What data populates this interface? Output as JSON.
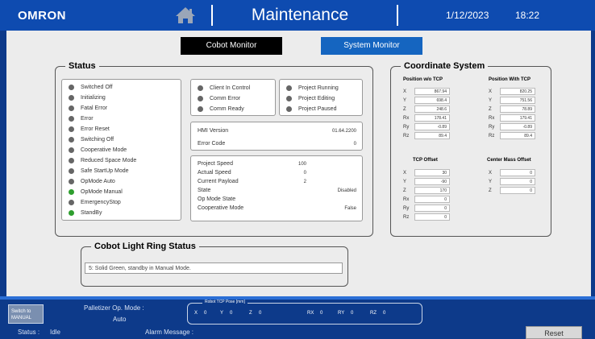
{
  "header": {
    "logo": "OMRON",
    "title": "Maintenance",
    "date": "1/12/2023",
    "time": "18:22"
  },
  "tabs": [
    {
      "label": "Cobot Monitor"
    },
    {
      "label": "System Monitor"
    }
  ],
  "status": {
    "legend": "Status",
    "states": [
      {
        "label": "Switched Off",
        "on": false
      },
      {
        "label": "Initializing",
        "on": false
      },
      {
        "label": "Fatal Error",
        "on": false
      },
      {
        "label": "Error",
        "on": false
      },
      {
        "label": "Error Reset",
        "on": false
      },
      {
        "label": "Switching Off",
        "on": false
      },
      {
        "label": "Cooperative Mode",
        "on": false
      },
      {
        "label": "Reduced Space Mode",
        "on": false
      },
      {
        "label": "Safe StartUp Mode",
        "on": false
      },
      {
        "label": "OpMode Auto",
        "on": false
      },
      {
        "label": "OpMode Manual",
        "on": true
      },
      {
        "label": "EmergencyStop",
        "on": false
      },
      {
        "label": "StandBy",
        "on": true
      }
    ],
    "comm": [
      {
        "label": "Client In Control"
      },
      {
        "label": "Comm Error"
      },
      {
        "label": "Comm Ready"
      }
    ],
    "project": [
      {
        "label": "Project Running"
      },
      {
        "label": "Project Editing"
      },
      {
        "label": "Project Paused"
      }
    ],
    "hmi": {
      "label": "HMI Version",
      "value": "01.64.2200"
    },
    "error_code": {
      "label": "Error Code",
      "value": "0"
    },
    "project_info": [
      {
        "label": "Project Speed",
        "value": "100"
      },
      {
        "label": "Actual Speed",
        "value": "0"
      },
      {
        "label": "Current Payload",
        "value": "2"
      },
      {
        "label": "State",
        "value": "Disabled"
      },
      {
        "label": "Op Mode State",
        "value": ""
      },
      {
        "label": "Cooperative Mode",
        "value": "False"
      }
    ]
  },
  "coord": {
    "legend": "Coordinate System",
    "pos_wo_tcp": {
      "title": "Position w/o TCP",
      "rows": [
        {
          "k": "X",
          "v": "867.94"
        },
        {
          "k": "Y",
          "v": "698.4"
        },
        {
          "k": "Z",
          "v": "248.6"
        },
        {
          "k": "Rx",
          "v": "178.41"
        },
        {
          "k": "Ry",
          "v": "-0.89"
        },
        {
          "k": "Rz",
          "v": "89.4"
        }
      ]
    },
    "pos_with_tcp": {
      "title": "Position With TCP",
      "rows": [
        {
          "k": "X",
          "v": "820.25"
        },
        {
          "k": "Y",
          "v": "751.56"
        },
        {
          "k": "Z",
          "v": "78.89"
        },
        {
          "k": "Rx",
          "v": "179.41"
        },
        {
          "k": "Ry",
          "v": "-0.89"
        },
        {
          "k": "Rz",
          "v": "89.4"
        }
      ]
    },
    "tcp_offset": {
      "title": "TCP Offset",
      "rows": [
        {
          "k": "X",
          "v": "30"
        },
        {
          "k": "Y",
          "v": "-90"
        },
        {
          "k": "Z",
          "v": "170"
        },
        {
          "k": "Rx",
          "v": "0"
        },
        {
          "k": "Ry",
          "v": "0"
        },
        {
          "k": "Rz",
          "v": "0"
        }
      ]
    },
    "center_mass": {
      "title": "Center Mass Offset",
      "rows": [
        {
          "k": "X",
          "v": "0"
        },
        {
          "k": "Y",
          "v": "0"
        },
        {
          "k": "Z",
          "v": "0"
        }
      ]
    }
  },
  "ring": {
    "legend": "Cobot Light Ring Status",
    "text": "5: Solid Green, standby in Manual Mode."
  },
  "footer": {
    "switch_label": "Switch to MANUAL",
    "palletizer_label": "Palletizer Op. Mode :",
    "palletizer_value": "Auto",
    "tcp_title": "Robot TCP Pose [mm]",
    "tcp": [
      {
        "k": "X",
        "v": "0"
      },
      {
        "k": "Y",
        "v": "0"
      },
      {
        "k": "Z",
        "v": "0"
      },
      {
        "k": "RX",
        "v": "0"
      },
      {
        "k": "RY",
        "v": "0"
      },
      {
        "k": "RZ",
        "v": "0"
      }
    ],
    "status_label": "Status :",
    "status_value": "Idle",
    "alarm_label": "Alarm Message :",
    "reset_label": "Reset"
  },
  "colors": {
    "header": "#0e4bb0",
    "background": "#0d3a8a",
    "accent": "#1565c0",
    "status_on": "#2e9e2e",
    "status_off": "#666666"
  }
}
